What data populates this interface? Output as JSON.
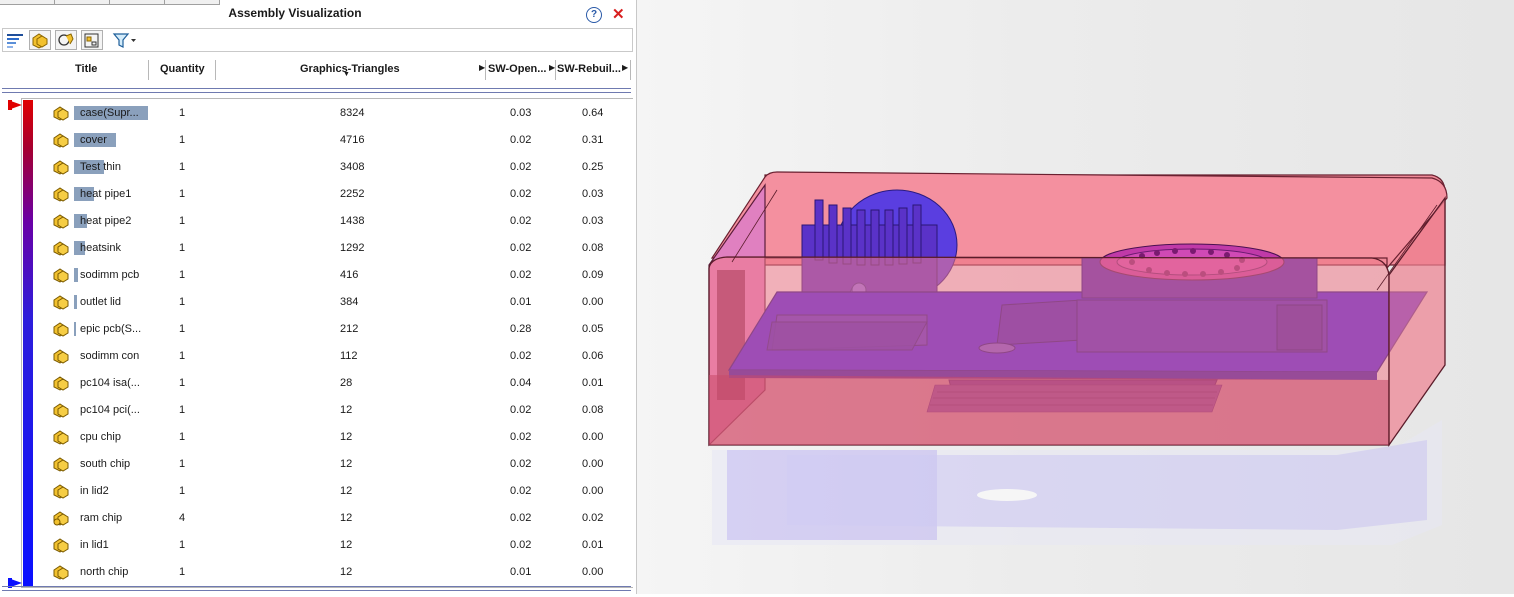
{
  "panel": {
    "title": "Assembly Visualization",
    "help_icon": "?",
    "close_icon": "✕",
    "toolbar": {
      "icons": [
        "gradient-bar-icon",
        "assembly-view-icon",
        "flat-view-icon",
        "columns-icon",
        "filter-icon"
      ]
    },
    "columns": {
      "title": "Title",
      "quantity": "Quantity",
      "graphics_triangles": "Graphics-Triangles",
      "sw_open": "SW-Open...",
      "sw_rebuild": "SW-Rebuil..."
    },
    "rows": [
      {
        "name": "case(Supr...",
        "qty": "1",
        "tri": "8324",
        "open": "0.03",
        "rebuild": "0.64",
        "bar": 1.0
      },
      {
        "name": "cover",
        "qty": "1",
        "tri": "4716",
        "open": "0.02",
        "rebuild": "0.31",
        "bar": 0.567
      },
      {
        "name": "Test thin",
        "qty": "1",
        "tri": "3408",
        "open": "0.02",
        "rebuild": "0.25",
        "bar": 0.409
      },
      {
        "name": "heat pipe1",
        "qty": "1",
        "tri": "2252",
        "open": "0.02",
        "rebuild": "0.03",
        "bar": 0.271
      },
      {
        "name": "heat pipe2",
        "qty": "1",
        "tri": "1438",
        "open": "0.02",
        "rebuild": "0.03",
        "bar": 0.173
      },
      {
        "name": "heatsink",
        "qty": "1",
        "tri": "1292",
        "open": "0.02",
        "rebuild": "0.08",
        "bar": 0.155
      },
      {
        "name": "sodimm pcb",
        "qty": "1",
        "tri": "416",
        "open": "0.02",
        "rebuild": "0.09",
        "bar": 0.05
      },
      {
        "name": "outlet lid",
        "qty": "1",
        "tri": "384",
        "open": "0.01",
        "rebuild": "0.00",
        "bar": 0.046
      },
      {
        "name": "epic pcb(S...",
        "qty": "1",
        "tri": "212",
        "open": "0.28",
        "rebuild": "0.05",
        "bar": 0.025
      },
      {
        "name": "sodimm con",
        "qty": "1",
        "tri": "112",
        "open": "0.02",
        "rebuild": "0.06",
        "bar": 0
      },
      {
        "name": "pc104 isa(...",
        "qty": "1",
        "tri": "28",
        "open": "0.04",
        "rebuild": "0.01",
        "bar": 0
      },
      {
        "name": "pc104 pci(...",
        "qty": "1",
        "tri": "12",
        "open": "0.02",
        "rebuild": "0.08",
        "bar": 0
      },
      {
        "name": "cpu chip",
        "qty": "1",
        "tri": "12",
        "open": "0.02",
        "rebuild": "0.00",
        "bar": 0
      },
      {
        "name": "south chip",
        "qty": "1",
        "tri": "12",
        "open": "0.02",
        "rebuild": "0.00",
        "bar": 0
      },
      {
        "name": "in lid2",
        "qty": "1",
        "tri": "12",
        "open": "0.02",
        "rebuild": "0.00",
        "bar": 0
      },
      {
        "name": "ram chip",
        "qty": "4",
        "tri": "12",
        "open": "0.02",
        "rebuild": "0.02",
        "bar": 0
      },
      {
        "name": "in lid1",
        "qty": "1",
        "tri": "12",
        "open": "0.02",
        "rebuild": "0.01",
        "bar": 0
      },
      {
        "name": "north chip",
        "qty": "1",
        "tri": "12",
        "open": "0.01",
        "rebuild": "0.00",
        "bar": 0
      }
    ]
  },
  "colors": {
    "accent_red": "#e00000",
    "accent_blue": "#0a10ff",
    "bar": "#8aa0bc",
    "part_icon": "#f2c12e",
    "case_pink": "#f07a8a",
    "board_blue": "#3a18e8"
  }
}
